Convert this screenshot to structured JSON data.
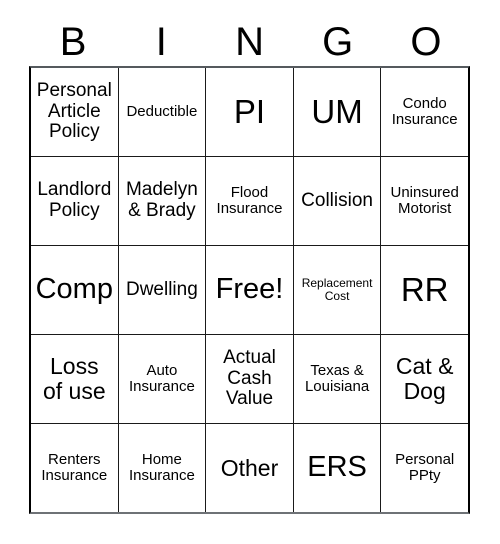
{
  "header": {
    "letters": [
      "B",
      "I",
      "N",
      "G",
      "O"
    ]
  },
  "grid": {
    "rows": [
      [
        {
          "text": "Personal\nArticle\nPolicy",
          "size": "fs-sm",
          "free": false
        },
        {
          "text": "Deductible",
          "size": "fs-xs",
          "free": false
        },
        {
          "text": "PI",
          "size": "fs-xl",
          "free": false
        },
        {
          "text": "UM",
          "size": "fs-xl",
          "free": false
        },
        {
          "text": "Condo\nInsurance",
          "size": "fs-xs",
          "free": false
        }
      ],
      [
        {
          "text": "Landlord\nPolicy",
          "size": "fs-sm",
          "free": false
        },
        {
          "text": "Madelyn\n& Brady",
          "size": "fs-sm",
          "free": false
        },
        {
          "text": "Flood\nInsurance",
          "size": "fs-xs",
          "free": false
        },
        {
          "text": "Collision",
          "size": "fs-sm",
          "free": false
        },
        {
          "text": "Uninsured\nMotorist",
          "size": "fs-xs",
          "free": false
        }
      ],
      [
        {
          "text": "Comp",
          "size": "fs-lg",
          "free": false
        },
        {
          "text": "Dwelling",
          "size": "fs-sm",
          "free": false
        },
        {
          "text": "Free!",
          "size": "fs-lg",
          "free": true
        },
        {
          "text": "Replacement\nCost",
          "size": "fs-xxs",
          "free": false
        },
        {
          "text": "RR",
          "size": "fs-xl",
          "free": false
        }
      ],
      [
        {
          "text": "Loss\nof use",
          "size": "fs-md",
          "free": false
        },
        {
          "text": "Auto\nInsurance",
          "size": "fs-xs",
          "free": false
        },
        {
          "text": "Actual\nCash\nValue",
          "size": "fs-sm",
          "free": false
        },
        {
          "text": "Texas &\nLouisiana",
          "size": "fs-xs",
          "free": false
        },
        {
          "text": "Cat &\nDog",
          "size": "fs-md",
          "free": false
        }
      ],
      [
        {
          "text": "Renters\nInsurance",
          "size": "fs-xs",
          "free": false
        },
        {
          "text": "Home\nInsurance",
          "size": "fs-xs",
          "free": false
        },
        {
          "text": "Other",
          "size": "fs-md",
          "free": false
        },
        {
          "text": "ERS",
          "size": "fs-lg",
          "free": false
        },
        {
          "text": "Personal\nPPty",
          "size": "fs-xs",
          "free": false
        }
      ]
    ]
  },
  "colors": {
    "background": "#ffffff",
    "text": "#000000",
    "grid_line": "#1a1a1a",
    "outer_border": "#000000"
  }
}
